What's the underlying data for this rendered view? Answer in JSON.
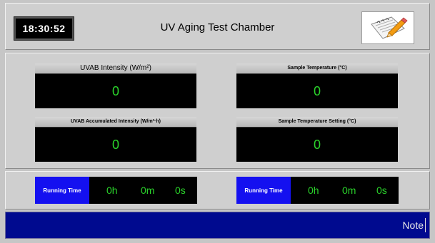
{
  "header": {
    "clock": "18:30:52",
    "title": "UV Aging Test Chamber",
    "note_icon": "notepad-pencil-icon"
  },
  "readings": [
    {
      "label": "UVAB Intensity (W/m²)",
      "value": "0"
    },
    {
      "label": "Sample Temperature (°C)",
      "value": "0"
    },
    {
      "label": "UVAB Accumulated Intensity (W/m²·h)",
      "value": "0"
    },
    {
      "label": "Sample Temperature Setting (°C)",
      "value": "0"
    }
  ],
  "timers": [
    {
      "label": "Running Time",
      "hours": "0h",
      "minutes": "0m",
      "seconds": "0s"
    },
    {
      "label": "Running Time",
      "hours": "0h",
      "minutes": "0m",
      "seconds": "0s"
    }
  ],
  "footer": {
    "note_label": "Note"
  },
  "colors": {
    "value_green": "#2bd42b",
    "running_blue": "#1410f0",
    "note_bar_blue": "#000a8f"
  }
}
